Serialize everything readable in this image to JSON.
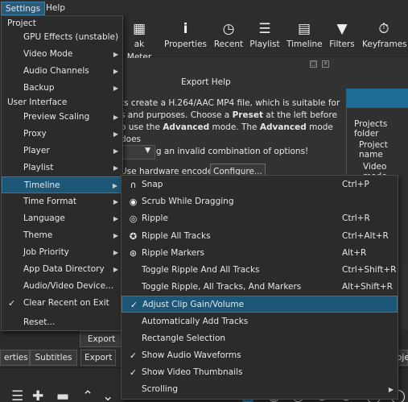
{
  "menubar": {
    "settings": "Settings",
    "help": "Help"
  },
  "toolbar": {
    "buttons": [
      {
        "label": "ak Meter",
        "icon": "peak-meter-icon"
      },
      {
        "label": "Properties",
        "icon": "info-icon"
      },
      {
        "label": "Recent",
        "icon": "clock-icon"
      },
      {
        "label": "Playlist",
        "icon": "playlist-icon"
      },
      {
        "label": "Timeline",
        "icon": "timeline-icon"
      },
      {
        "label": "Filters",
        "icon": "filter-icon"
      },
      {
        "label": "Keyframes",
        "icon": "stopwatch-icon"
      }
    ]
  },
  "export": {
    "title": "Export Help",
    "help_line1": "ts create a H.264/AAC MP4 file, which is suitable for",
    "help_line2": "s and purposes. Choose a ",
    "help_preset": "Preset",
    "help_line2b": " at the left before",
    "help_line3a": "o use the ",
    "help_advanced": "Advanced",
    "help_line3b": " mode. The ",
    "help_advanced2": "Advanced",
    "help_line3c": " mode does",
    "help_line4": "t creating an invalid combination of options!",
    "hw_encoder": "Use hardware encoder",
    "configure": "Configure...",
    "export_file": "Export Fi",
    "pin_icon": "pin-icon",
    "close_icon": "close-icon"
  },
  "rightpane": {
    "projects_folder": "Projects folder",
    "project_name": "Project name",
    "video_mode": "Video mode"
  },
  "tabs": {
    "properties": "erties",
    "subtitles": "Subtitles",
    "export": "Export",
    "right_fragment": "oje"
  },
  "settings_menu": {
    "section_project": "Project",
    "section_ui": "User Interface",
    "items": [
      {
        "label": "GPU Effects (unstable)",
        "sub": false,
        "checked": false
      },
      {
        "label": "Video Mode",
        "sub": true,
        "checked": false
      },
      {
        "label": "Audio Channels",
        "sub": true,
        "checked": false
      },
      {
        "label": "Backup",
        "sub": true,
        "checked": false
      },
      {
        "label": "Preview Scaling",
        "sub": true,
        "checked": false
      },
      {
        "label": "Proxy",
        "sub": true,
        "checked": false
      },
      {
        "label": "Player",
        "sub": true,
        "checked": false
      },
      {
        "label": "Playlist",
        "sub": true,
        "checked": false
      },
      {
        "label": "Timeline",
        "sub": true,
        "checked": false,
        "highlighted": true
      },
      {
        "label": "Time Format",
        "sub": true,
        "checked": false
      },
      {
        "label": "Language",
        "sub": true,
        "checked": false
      },
      {
        "label": "Theme",
        "sub": true,
        "checked": false
      },
      {
        "label": "Job Priority",
        "sub": true,
        "checked": false
      },
      {
        "label": "App Data Directory",
        "sub": true,
        "checked": false
      },
      {
        "label": "Audio/Video Device...",
        "sub": false,
        "checked": false
      },
      {
        "label": "Clear Recent on Exit",
        "sub": false,
        "checked": true
      },
      {
        "label": "Reset...",
        "sub": false,
        "checked": false
      }
    ]
  },
  "timeline_menu": {
    "items": [
      {
        "label": "Snap",
        "shortcut": "Ctrl+P",
        "icon": "magnet-icon",
        "glyph": "∩"
      },
      {
        "label": "Scrub While Dragging",
        "shortcut": "",
        "icon": "eye-icon",
        "glyph": "◉"
      },
      {
        "label": "Ripple",
        "shortcut": "Ctrl+R",
        "icon": "ripple-icon",
        "glyph": "◎"
      },
      {
        "label": "Ripple All Tracks",
        "shortcut": "Ctrl+Alt+R",
        "icon": "ripple-all-icon",
        "glyph": "✪"
      },
      {
        "label": "Ripple Markers",
        "shortcut": "Alt+R",
        "icon": "ripple-markers-icon",
        "glyph": "⊛"
      },
      {
        "label": "Toggle Ripple And All Tracks",
        "shortcut": "Ctrl+Shift+R",
        "icon": "",
        "glyph": ""
      },
      {
        "label": "Toggle Ripple, All Tracks, And Markers",
        "shortcut": "Alt+Shift+R",
        "icon": "",
        "glyph": ""
      },
      {
        "label": "Adjust Clip Gain/Volume",
        "shortcut": "",
        "icon": "",
        "glyph": "✓",
        "highlighted": true
      },
      {
        "label": "Automatically Add Tracks",
        "shortcut": "",
        "icon": "",
        "glyph": ""
      },
      {
        "label": "Rectangle Selection",
        "shortcut": "",
        "icon": "",
        "glyph": ""
      },
      {
        "label": "Show Audio Waveforms",
        "shortcut": "",
        "icon": "",
        "glyph": "✓"
      },
      {
        "label": "Show Video Thumbnails",
        "shortcut": "",
        "icon": "",
        "glyph": "✓"
      },
      {
        "label": "Scrolling",
        "shortcut": "",
        "icon": "",
        "glyph": "",
        "sub": true
      }
    ]
  }
}
